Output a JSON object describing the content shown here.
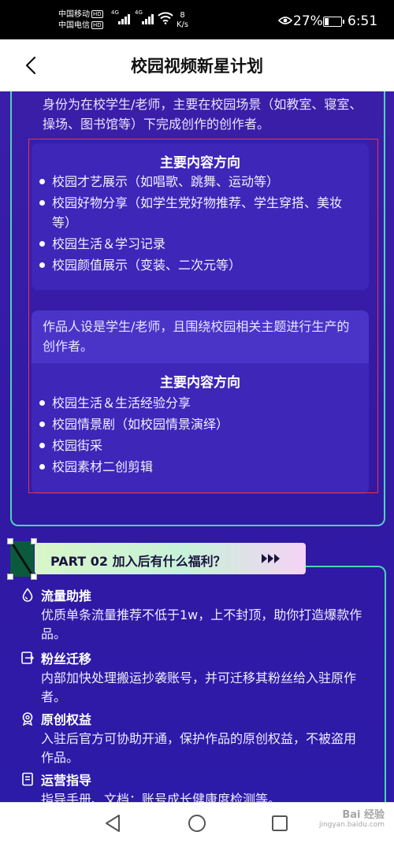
{
  "status_bar": {
    "carrier_1": "中国移动",
    "carrier_2": "中国电信",
    "hd_badge": "HD",
    "network_type": "4G",
    "net_speed_value": "8",
    "net_speed_unit": "K/s",
    "battery_percent": "27%",
    "battery_level": 0.27,
    "time": "6:51"
  },
  "header": {
    "title": "校园视频新星计划"
  },
  "creator_types": {
    "type1_description": "身份为在校学生/老师，主要在校园场景（如教室、寝室、操场、图书馆等）下完成创作的创作者。",
    "type1_section_title": "主要内容方向",
    "type1_items": [
      "校园才艺展示（如唱歌、跳舞、运动等）",
      "校园好物分享（如学生党好物推荐、学生穿搭、美妆等）",
      "校园生活＆学习记录",
      "校园颜值展示（变装、二次元等）"
    ],
    "type2_description": "作品人设是学生/老师，且围绕校园相关主题进行生产的创作者。",
    "type2_section_title": "主要内容方向",
    "type2_items": [
      "校园生活＆生活经验分享",
      "校园情景剧（如校园情景演绎）",
      "校园街采",
      "校园素材二创剪辑"
    ]
  },
  "part02": {
    "label": "PART 02  加入后有什么福利？",
    "arrows": "▶▶▶"
  },
  "benefits": [
    {
      "icon": "water-drop-icon",
      "title": "流量助推",
      "description": "优质单条流量推荐不低于1w，上不封顶，助你打造爆款作品。"
    },
    {
      "icon": "transfer-icon",
      "title": "粉丝迁移",
      "description": "内部加快处理搬运抄袭账号，并可迁移其粉丝给入驻原作者。"
    },
    {
      "icon": "badge-icon",
      "title": "原创权益",
      "description": "入驻后官方可协助开通，保护作品的原创权益，不被盗用作品。"
    },
    {
      "icon": "guide-icon",
      "title": "运营指导",
      "description": "指导手册、文档：账号成长健康度检测等。"
    }
  ],
  "watermark": {
    "brand": "Bai 经验",
    "url": "jingyan.baidu.com"
  },
  "colors": {
    "background": "#3119a3",
    "card_border": "#49d6b3",
    "highlight_border": "#e8364b"
  }
}
